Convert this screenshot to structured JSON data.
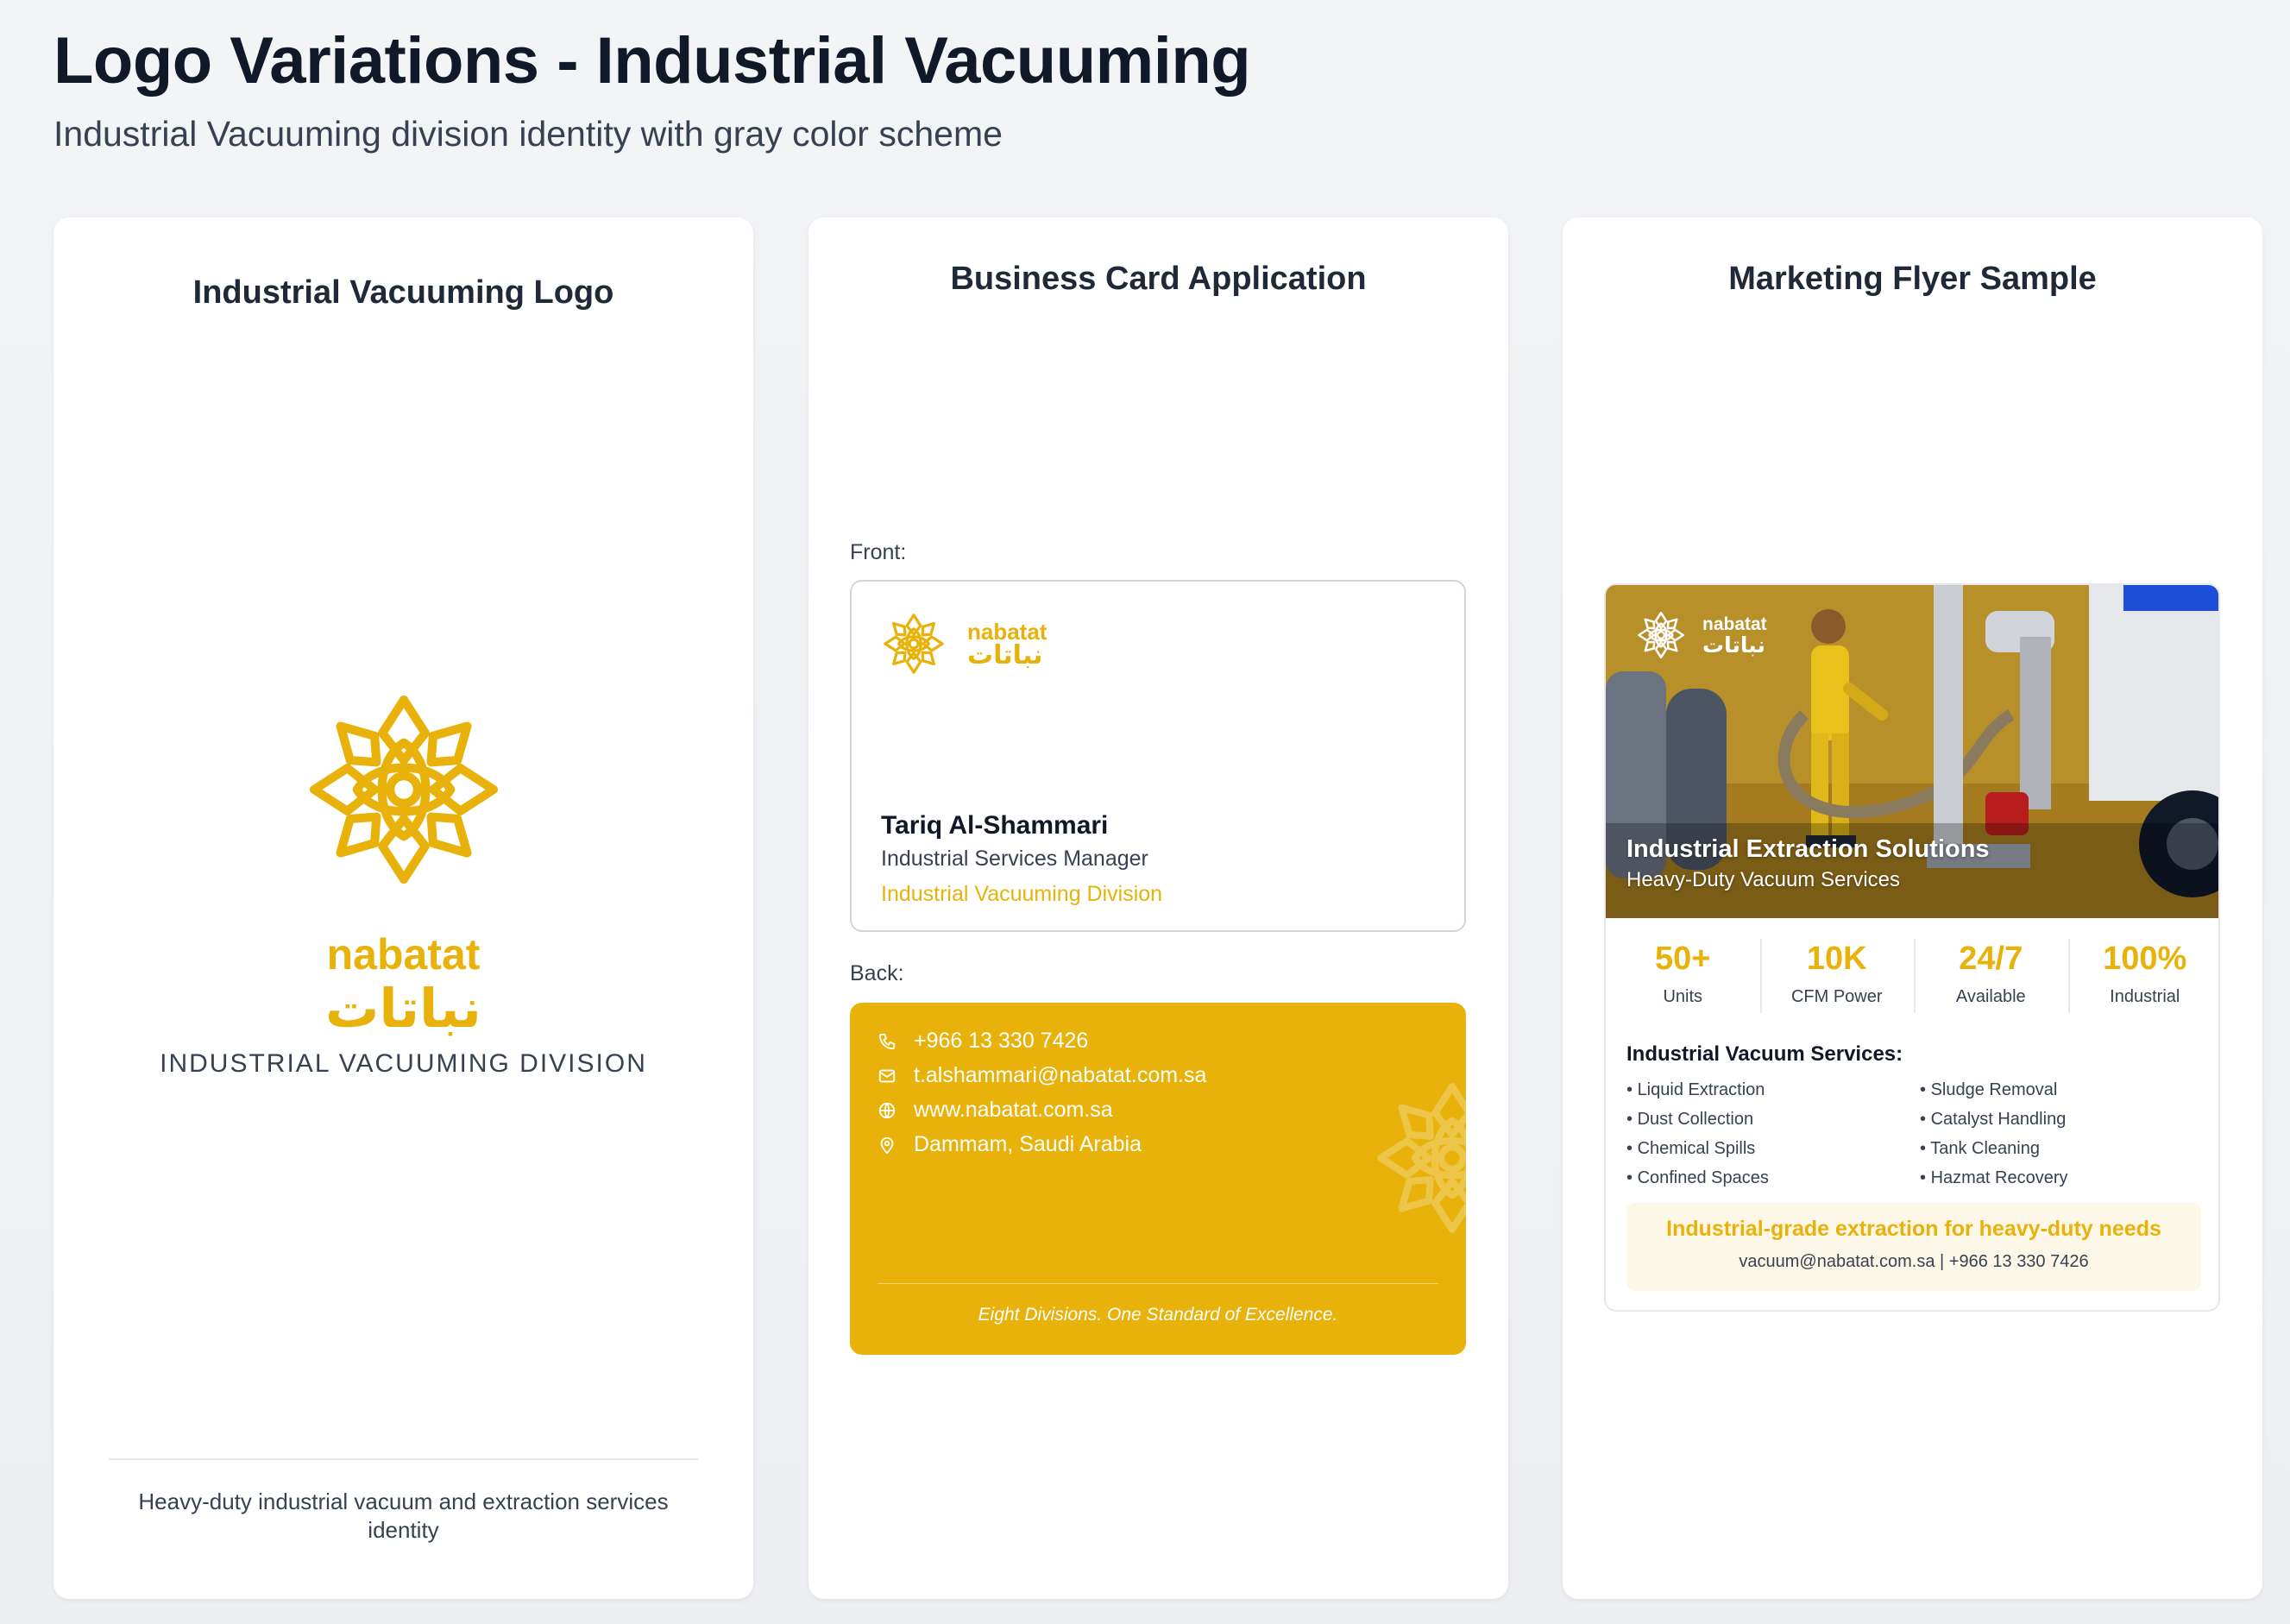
{
  "header": {
    "title": "Logo Variations - Industrial Vacuuming",
    "subtitle": "Industrial Vacuuming division identity with gray color scheme"
  },
  "colors": {
    "accent": "#e8b20a",
    "text_dark": "#111827",
    "text_muted": "#374151",
    "card_bg": "#ffffff"
  },
  "logo_card": {
    "title": "Industrial Vacuuming Logo",
    "brand_name": "nabatat",
    "brand_arabic": "نباتات",
    "division": "INDUSTRIAL VACUUMING DIVISION",
    "footer": "Heavy-duty industrial vacuum and extraction services identity",
    "logo_icon": "lotus-knot-icon"
  },
  "business_card": {
    "title": "Business Card Application",
    "front_label": "Front:",
    "back_label": "Back:",
    "front": {
      "brand_name": "nabatat",
      "brand_arabic": "نباتات",
      "name": "Tariq Al-Shammari",
      "role": "Industrial Services Manager",
      "division": "Industrial Vacuuming Division"
    },
    "back": {
      "phone": "+966 13 330 7426",
      "email": "t.alshammari@nabatat.com.sa",
      "website": "www.nabatat.com.sa",
      "location": "Dammam, Saudi Arabia",
      "tagline": "Eight Divisions. One Standard of Excellence."
    }
  },
  "flyer": {
    "title": "Marketing Flyer Sample",
    "brand_name": "nabatat",
    "brand_arabic": "نباتات",
    "headline": "Industrial Extraction Solutions",
    "subheadline": "Heavy-Duty Vacuum Services",
    "stats": [
      {
        "value": "50+",
        "label": "Units"
      },
      {
        "value": "10K",
        "label": "CFM Power"
      },
      {
        "value": "24/7",
        "label": "Available"
      },
      {
        "value": "100%",
        "label": "Industrial"
      }
    ],
    "services_title": "Industrial Vacuum Services:",
    "services_left": [
      "Liquid Extraction",
      "Dust Collection",
      "Chemical Spills",
      "Confined Spaces"
    ],
    "services_right": [
      "Sludge Removal",
      "Catalyst Handling",
      "Tank Cleaning",
      "Hazmat Recovery"
    ],
    "cta_headline": "Industrial-grade extraction for heavy-duty needs",
    "cta_contact": "vacuum@nabatat.com.sa | +966 13 330 7426"
  }
}
